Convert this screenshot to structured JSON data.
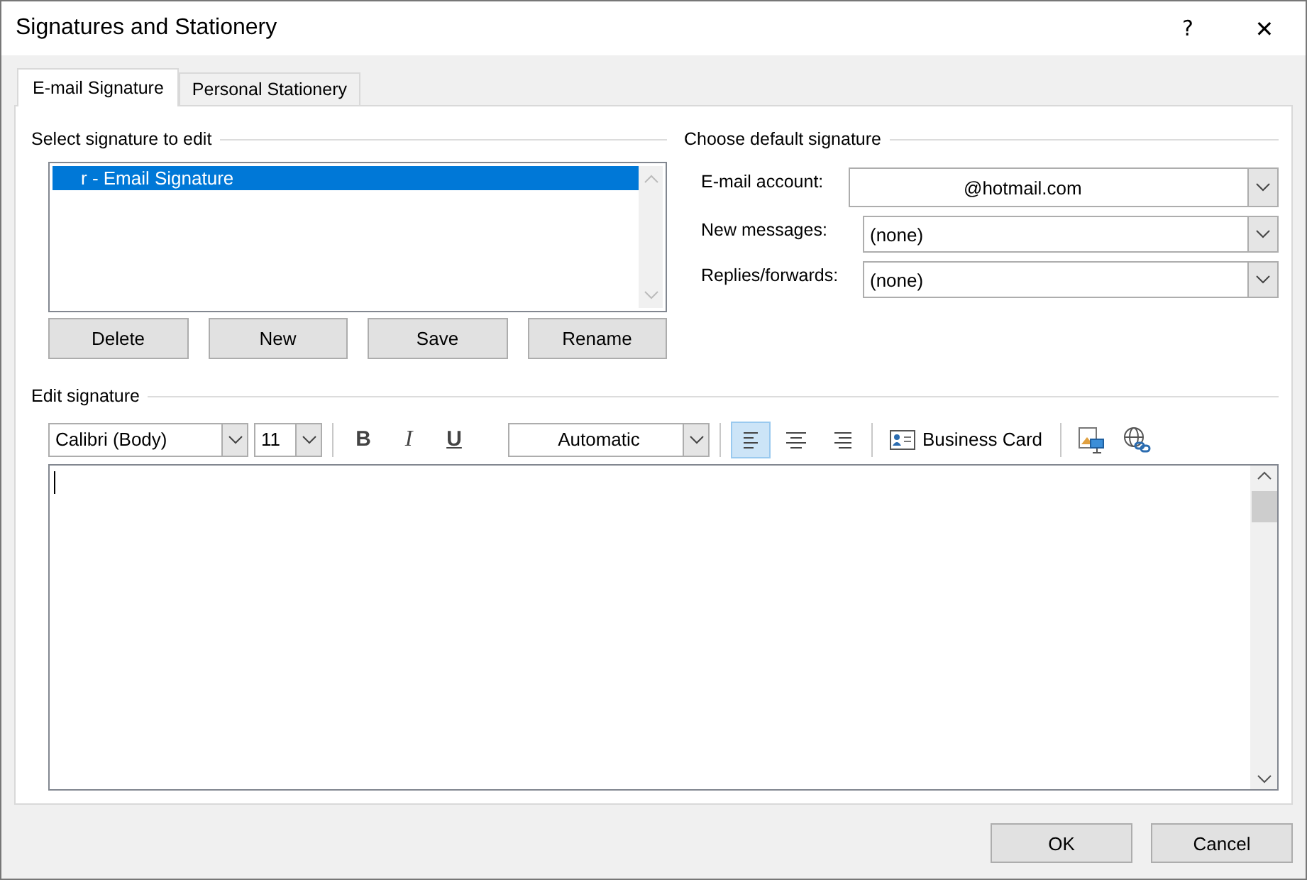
{
  "window": {
    "title": "Signatures and Stationery",
    "help": "?",
    "close": "✕"
  },
  "tabs": [
    {
      "label": "E-mail Signature",
      "selected": true
    },
    {
      "label": "Personal Stationery",
      "selected": false
    }
  ],
  "select_group": {
    "label": "Select signature to edit",
    "items": [
      {
        "label": "r - Email Signature",
        "selected": true
      }
    ],
    "buttons": [
      "Delete",
      "New",
      "Save",
      "Rename"
    ]
  },
  "default_group": {
    "label": "Choose default signature",
    "fields": [
      {
        "label": "E-mail account:",
        "value": "@hotmail.com"
      },
      {
        "label": "New messages:",
        "value": "(none)"
      },
      {
        "label": "Replies/forwards:",
        "value": "(none)"
      }
    ]
  },
  "edit_group": {
    "label": "Edit signature",
    "toolbar": [
      {
        "kind": "font",
        "value": "Calibri (Body)"
      },
      {
        "kind": "size",
        "value": "11"
      },
      {
        "kind": "sep"
      },
      {
        "kind": "bold",
        "text": "B"
      },
      {
        "kind": "italic",
        "text": "I"
      },
      {
        "kind": "underline",
        "text": "U"
      },
      {
        "kind": "color",
        "value": "Automatic"
      },
      {
        "kind": "sep"
      },
      {
        "kind": "align-left",
        "selected": true
      },
      {
        "kind": "align-center",
        "selected": false
      },
      {
        "kind": "align-right",
        "selected": false
      },
      {
        "kind": "sep"
      },
      {
        "kind": "card",
        "text": "Business Card"
      },
      {
        "kind": "sep"
      },
      {
        "kind": "picture-insert"
      },
      {
        "kind": "link-insert"
      }
    ]
  },
  "footer": {
    "buttons": [
      "OK",
      "Cancel"
    ]
  }
}
